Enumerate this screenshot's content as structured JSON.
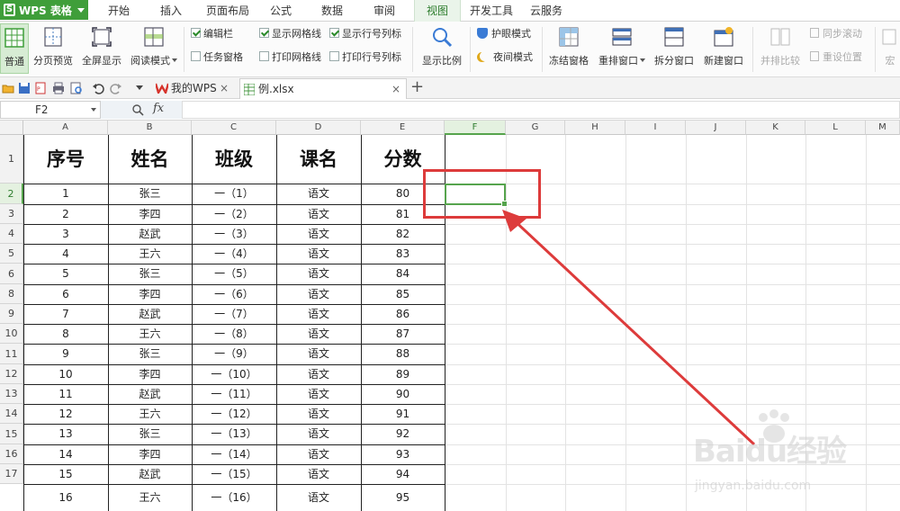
{
  "app": {
    "badge": "WPS 表格"
  },
  "menu": {
    "tabs": [
      "开始",
      "插入",
      "页面布局",
      "公式",
      "数据",
      "审阅",
      "视图",
      "开发工具",
      "云服务"
    ],
    "active": "视图"
  },
  "ribbon": {
    "normal": "普通",
    "page_preview": "分页预览",
    "fullscreen": "全屏显示",
    "reading_mode": "阅读模式",
    "edit_bar": "编辑栏",
    "task_pane": "任务窗格",
    "show_gridlines": "显示网格线",
    "print_gridlines": "打印网格线",
    "show_rowcol": "显示行号列标",
    "print_rowcol": "打印行号列标",
    "zoom": "显示比例",
    "eye_mode": "护眼模式",
    "night_mode": "夜间模式",
    "freeze": "冻结窗格",
    "rearrange": "重排窗口",
    "split": "拆分窗口",
    "new_window": "新建窗口",
    "side_by_side": "并排比较",
    "sync_scroll": "同步滚动",
    "reset_position": "重设位置",
    "macro": "宏",
    "checks": {
      "edit_bar": true,
      "task_pane": false,
      "show_gridlines": true,
      "print_gridlines": false,
      "show_rowcol": true,
      "print_rowcol": false
    }
  },
  "doc_tabs": [
    {
      "label": "我的WPS"
    },
    {
      "label": "例.xlsx"
    }
  ],
  "formula_bar": {
    "name_box": "F2",
    "fx": "fx",
    "value": ""
  },
  "sheet": {
    "columns": [
      "A",
      "B",
      "C",
      "D",
      "E",
      "F",
      "G",
      "H",
      "I",
      "J",
      "K",
      "L",
      "M"
    ],
    "selected_col": "F",
    "row_numbers": [
      "1",
      "2",
      "3",
      "4",
      "5",
      "6",
      "8",
      "9",
      "10",
      "11",
      "12",
      "13",
      "14",
      "15",
      "16",
      "17"
    ],
    "selected_row": "2",
    "headers": [
      "序号",
      "姓名",
      "班级",
      "课名",
      "分数"
    ],
    "rows": [
      [
        "1",
        "张三",
        "一（1）",
        "语文",
        "80"
      ],
      [
        "2",
        "李四",
        "一（2）",
        "语文",
        "81"
      ],
      [
        "3",
        "赵武",
        "一（3）",
        "语文",
        "82"
      ],
      [
        "4",
        "王六",
        "一（4）",
        "语文",
        "83"
      ],
      [
        "5",
        "张三",
        "一（5）",
        "语文",
        "84"
      ],
      [
        "6",
        "李四",
        "一（6）",
        "语文",
        "85"
      ],
      [
        "7",
        "赵武",
        "一（7）",
        "语文",
        "86"
      ],
      [
        "8",
        "王六",
        "一（8）",
        "语文",
        "87"
      ],
      [
        "9",
        "张三",
        "一（9）",
        "语文",
        "88"
      ],
      [
        "10",
        "李四",
        "一（10）",
        "语文",
        "89"
      ],
      [
        "11",
        "赵武",
        "一（11）",
        "语文",
        "90"
      ],
      [
        "12",
        "王六",
        "一（12）",
        "语文",
        "91"
      ],
      [
        "13",
        "张三",
        "一（13）",
        "语文",
        "92"
      ],
      [
        "14",
        "李四",
        "一（14）",
        "语文",
        "93"
      ],
      [
        "15",
        "赵武",
        "一（15）",
        "语文",
        "94"
      ],
      [
        "16",
        "王六",
        "一（16）",
        "语文",
        "95"
      ]
    ]
  },
  "watermark": {
    "brand": "Baidu经验",
    "url": "jingyan.baidu.com"
  },
  "colors": {
    "accent": "#3f9e3a",
    "annotation": "#dd3b3b"
  }
}
